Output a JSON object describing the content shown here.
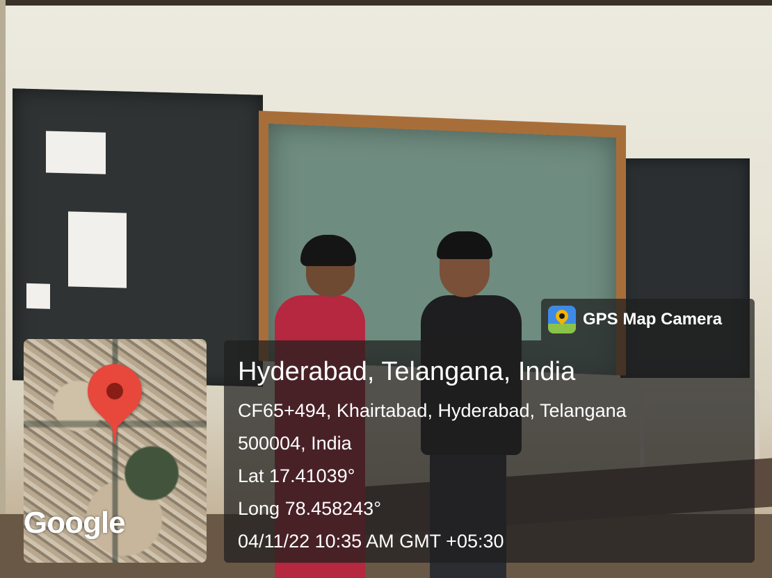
{
  "overlay": {
    "app_name": "GPS Map Camera",
    "app_icon": "gps-map-camera-app-icon",
    "location_title": "Hyderabad, Telangana, India",
    "address_line1": "CF65+494, Khairtabad, Hyderabad, Telangana",
    "address_line2": "500004, India",
    "latitude": "Lat 17.41039°",
    "longitude": "Long 78.458243°",
    "datetime": "04/11/22 10:35 AM GMT +05:30"
  },
  "map": {
    "attribution": "Google",
    "pin_icon": "map-location-pin-icon",
    "pin_color": "#e8473c"
  }
}
